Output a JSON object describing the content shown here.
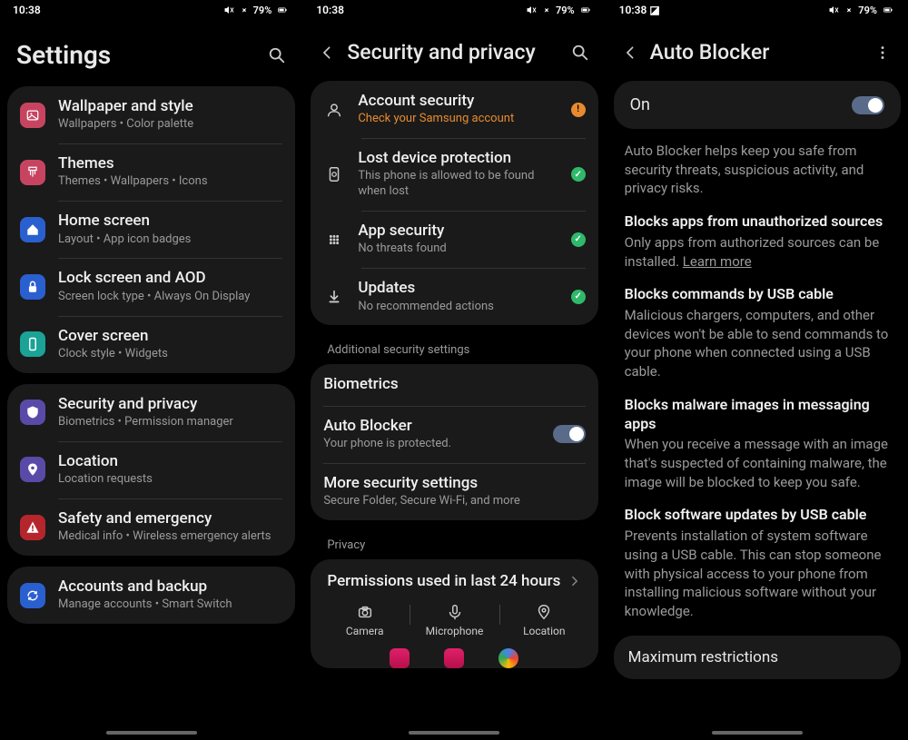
{
  "status": {
    "time": "10:38",
    "battery": "79%"
  },
  "screen1": {
    "title": "Settings",
    "groups": [
      [
        {
          "icon_bg": "#c74460",
          "svg": "image",
          "title": "Wallpaper and style",
          "sub": "Wallpapers  •  Color palette"
        },
        {
          "icon_bg": "#c74460",
          "svg": "brush",
          "title": "Themes",
          "sub": "Themes  •  Wallpapers  •  Icons"
        },
        {
          "icon_bg": "#2a5fd0",
          "svg": "home",
          "title": "Home screen",
          "sub": "Layout  •  App icon badges"
        },
        {
          "icon_bg": "#2a5fd0",
          "svg": "lock",
          "title": "Lock screen and AOD",
          "sub": "Screen lock type  •  Always On Display"
        },
        {
          "icon_bg": "#1aa396",
          "svg": "phone",
          "title": "Cover screen",
          "sub": "Clock style  •  Widgets"
        }
      ],
      [
        {
          "icon_bg": "#5a4aa8",
          "svg": "shield",
          "title": "Security and privacy",
          "sub": "Biometrics  •  Permission manager"
        },
        {
          "icon_bg": "#5a4aa8",
          "svg": "pin",
          "title": "Location",
          "sub": "Location requests"
        },
        {
          "icon_bg": "#b5262c",
          "svg": "alert",
          "title": "Safety and emergency",
          "sub": "Medical info  •  Wireless emergency alerts"
        }
      ],
      [
        {
          "icon_bg": "#2a5fd0",
          "svg": "sync",
          "title": "Accounts and backup",
          "sub": "Manage accounts  •  Smart Switch"
        }
      ]
    ]
  },
  "screen2": {
    "title": "Security and privacy",
    "items": [
      {
        "svg": "user",
        "title": "Account security",
        "sub": "Check your Samsung account",
        "sub_warn": true,
        "status": "orange"
      },
      {
        "svg": "phonefind",
        "title": "Lost device protection",
        "sub": "This phone is allowed to be found when lost",
        "status": "green"
      },
      {
        "svg": "grid",
        "title": "App security",
        "sub": "No threats found",
        "status": "green"
      },
      {
        "svg": "download",
        "title": "Updates",
        "sub": "No recommended actions",
        "status": "green"
      }
    ],
    "section1_label": "Additional security settings",
    "section1": [
      {
        "title": "Biometrics"
      },
      {
        "title": "Auto Blocker",
        "sub": "Your phone is protected.",
        "toggle": true
      },
      {
        "title": "More security settings",
        "sub": "Secure Folder, Secure Wi-Fi, and more"
      }
    ],
    "section2_label": "Privacy",
    "perms": {
      "title": "Permissions used in last 24 hours",
      "items": [
        {
          "label": "Camera",
          "svg": "camera"
        },
        {
          "label": "Microphone",
          "svg": "mic"
        },
        {
          "label": "Location",
          "svg": "pin"
        }
      ]
    }
  },
  "screen3": {
    "title": "Auto Blocker",
    "on_label": "On",
    "intro": "Auto Blocker helps keep you safe from security threats, suspicious activity, and privacy risks.",
    "blocks": [
      {
        "title": "Blocks apps from unauthorized sources",
        "body": "Only apps from authorized sources can be installed. ",
        "link": "Learn more"
      },
      {
        "title": "Blocks commands by USB cable",
        "body": "Malicious chargers, computers, and other devices won't be able to send commands to your phone when connected using a USB cable."
      },
      {
        "title": "Blocks malware images in messaging apps",
        "body": "When you receive a message with an image that's suspected of containing malware, the image will be blocked to keep you safe."
      },
      {
        "title": "Block software updates by USB cable",
        "body": "Prevents installation of system software using a USB cable. This can stop someone with physical access to your phone from installing malicious software without your knowledge."
      }
    ],
    "footer_item": "Maximum restrictions"
  }
}
